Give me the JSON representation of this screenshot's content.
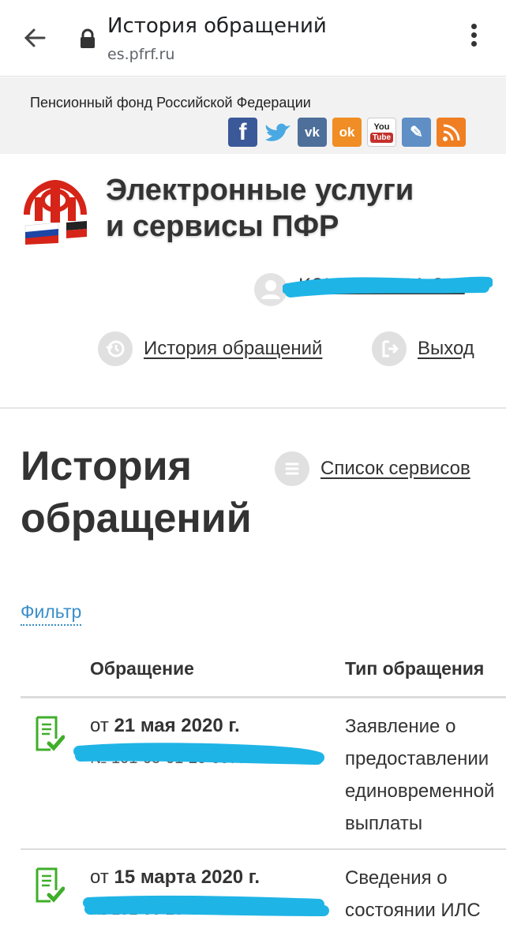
{
  "browser": {
    "page_title": "История обращений",
    "url": "es.pfrf.ru"
  },
  "top_strip": {
    "org_name": "Пенсионный фонд Российской Федерации",
    "social": [
      {
        "name": "facebook-icon",
        "glyph": "f",
        "color": "#3b5998"
      },
      {
        "name": "twitter-icon",
        "glyph": "t",
        "color": "#4aa9e2"
      },
      {
        "name": "vk-icon",
        "glyph": "vk",
        "color": "#4d6f99"
      },
      {
        "name": "odnoklassniki-icon",
        "glyph": "ok",
        "color": "#f08d24"
      },
      {
        "name": "youtube-icon",
        "glyph": "You",
        "color": "#b01d1d"
      },
      {
        "name": "livejournal-icon",
        "glyph": "✎",
        "color": "#4c7fb3"
      },
      {
        "name": "rss-icon",
        "glyph": ")))",
        "color": "#f07e22"
      }
    ]
  },
  "header": {
    "site_title_line1": "Электронные услуги",
    "site_title_line2": "и сервисы ПФР",
    "user_name": "КОНОВАЛОВА С.Г.",
    "history_link": "История обращений",
    "logout_link": "Выход"
  },
  "main": {
    "title_line1": "История",
    "title_line2": "обращений",
    "services_link": "Список сервисов",
    "filter_link": "Фильтр",
    "columns": {
      "request": "Обращение",
      "type": "Тип обращения"
    },
    "rows": [
      {
        "date_prefix": "от",
        "date": "21 мая 2020 г.",
        "number": "№ 101-05-01-20-0077018",
        "type": "Заявление о\nпредоставлении\nединовременной\nвыплаты"
      },
      {
        "date_prefix": "от",
        "date": "15 марта 2020 г.",
        "number": "№ 101-06-20-0002477742",
        "type": "Сведения о\nсостоянии ИЛС"
      }
    ]
  },
  "colors": {
    "link": "#3a8ec9",
    "scribble": "#1fb4e6",
    "doc_icon_green": "#3fae2a"
  }
}
